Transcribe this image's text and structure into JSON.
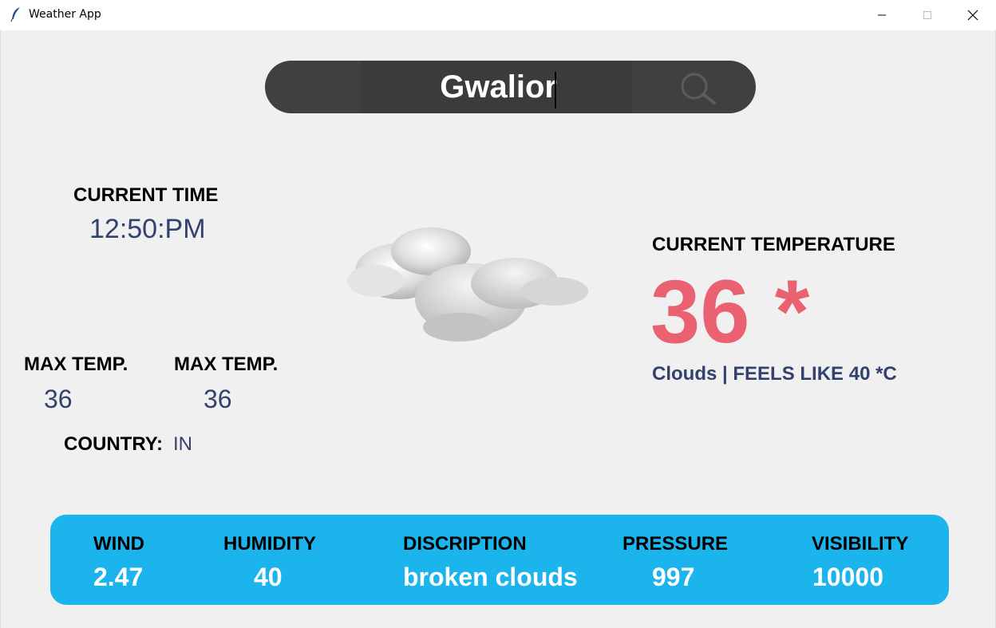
{
  "window": {
    "title": "Weather App",
    "icon": "feather-icon",
    "controls": [
      "minimize-icon",
      "maximize-icon",
      "close-icon"
    ]
  },
  "search": {
    "value": "Gwalior",
    "icon": "search-icon"
  },
  "current_time": {
    "label": "CURRENT TIME",
    "value": "12:50:PM"
  },
  "temps": {
    "max_label_1": "MAX TEMP.",
    "max_value_1": "36",
    "max_label_2": "MAX TEMP.",
    "max_value_2": "36"
  },
  "country": {
    "label": "COUNTRY:",
    "value": "IN"
  },
  "weather_icon": "cloud-icon",
  "current_temperature": {
    "label": "CURRENT TEMPERATURE",
    "value": "36 *",
    "summary": "Clouds | FEELS LIKE 40 *C"
  },
  "info_bar": {
    "items": [
      {
        "label": "WIND",
        "value": "2.47"
      },
      {
        "label": "HUMIDITY",
        "value": "40"
      },
      {
        "label": "DISCRIPTION",
        "value": "broken clouds"
      },
      {
        "label": "PRESSURE",
        "value": "997"
      },
      {
        "label": "VISIBILITY",
        "value": "10000"
      }
    ]
  },
  "colors": {
    "temp_accent": "#ea6272",
    "value_text": "#33416e",
    "bar_bg": "#1cb4ec",
    "search_bg": "#404040"
  }
}
